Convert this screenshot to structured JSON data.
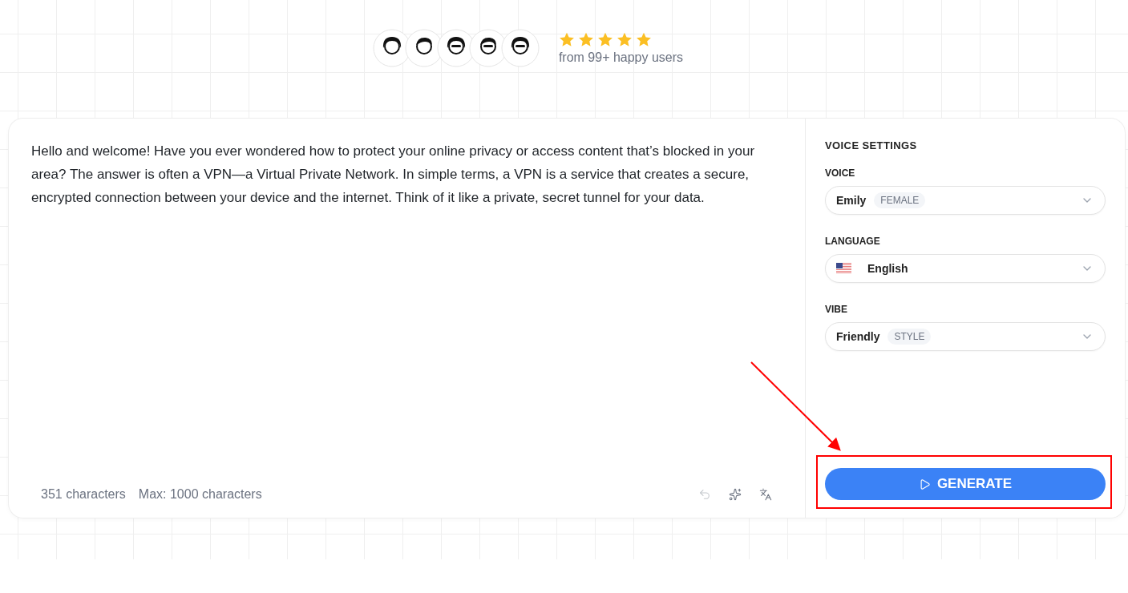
{
  "social_proof": {
    "stars": 5,
    "caption": "from 99+ happy users"
  },
  "editor": {
    "value": "Hello and welcome! Have you ever wondered how to protect your online privacy or access content that’s blocked in your area? The answer is often a VPN—a Virtual Private Network. In simple terms, a VPN is a service that creates a secure, encrypted connection between your device and the internet. Think of it like a private, secret tunnel for your data.",
    "char_count": "351 characters",
    "max": "Max: 1000 characters",
    "tools": [
      {
        "kind": "undo",
        "disabled": true
      },
      {
        "kind": "sparkles",
        "disabled": false
      },
      {
        "kind": "translate",
        "disabled": false
      }
    ]
  },
  "voice_settings": {
    "title": "VOICE SETTINGS",
    "fields": [
      {
        "label": "VOICE",
        "kind": "tagged",
        "value": "Emily",
        "tag": "FEMALE"
      },
      {
        "label": "LANGUAGE",
        "kind": "flag",
        "value": "English"
      },
      {
        "label": "VIBE",
        "kind": "tagged",
        "value": "Friendly",
        "tag": "STYLE"
      }
    ],
    "button": "GENERATE"
  }
}
